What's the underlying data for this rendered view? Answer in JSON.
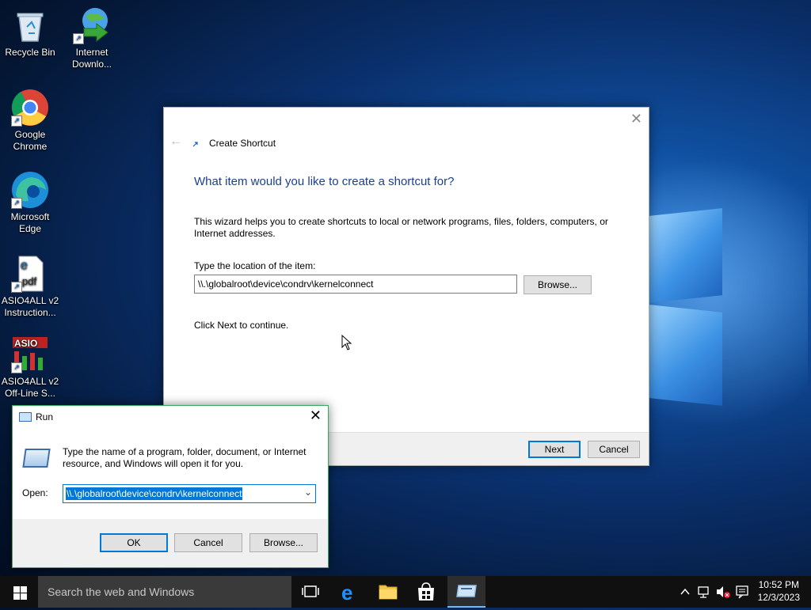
{
  "desktop": {
    "icons": [
      {
        "label": "Recycle Bin",
        "icon": "recycle-bin-icon"
      },
      {
        "label": "Internet Downlo...",
        "icon": "internet-download-manager-icon"
      },
      {
        "label": "Google Chrome",
        "icon": "chrome-icon"
      },
      {
        "label": "Microsoft Edge",
        "icon": "edge-icon"
      },
      {
        "label": "ASIO4ALL v2 Instruction...",
        "icon": "pdf-document-icon"
      },
      {
        "label": "ASIO4ALL v2 Off-Line S...",
        "icon": "asio4all-icon"
      }
    ]
  },
  "wizard": {
    "title": "Create Shortcut",
    "heading": "What item would you like to create a shortcut for?",
    "description": "This wizard helps you to create shortcuts to local or network programs, files, folders, computers, or Internet addresses.",
    "field_label": "Type the location of the item:",
    "location_value": "\\\\.\\globalroot\\device\\condrv\\kernelconnect",
    "browse_label": "Browse...",
    "hint": "Click Next to continue.",
    "next_label": "Next",
    "cancel_label": "Cancel"
  },
  "run": {
    "title": "Run",
    "description": "Type the name of a program, folder, document, or Internet resource, and Windows will open it for you.",
    "open_label": "Open:",
    "open_value": "\\\\.\\globalroot\\device\\condrv\\kernelconnect",
    "ok_label": "OK",
    "cancel_label": "Cancel",
    "browse_label": "Browse..."
  },
  "taskbar": {
    "search_placeholder": "Search the web and Windows",
    "time": "10:52 PM",
    "date": "12/3/2023"
  },
  "colors": {
    "accent": "#0078d7",
    "heading": "#1b3f8f",
    "taskbar": "#101010",
    "run_border": "#3aa862"
  }
}
